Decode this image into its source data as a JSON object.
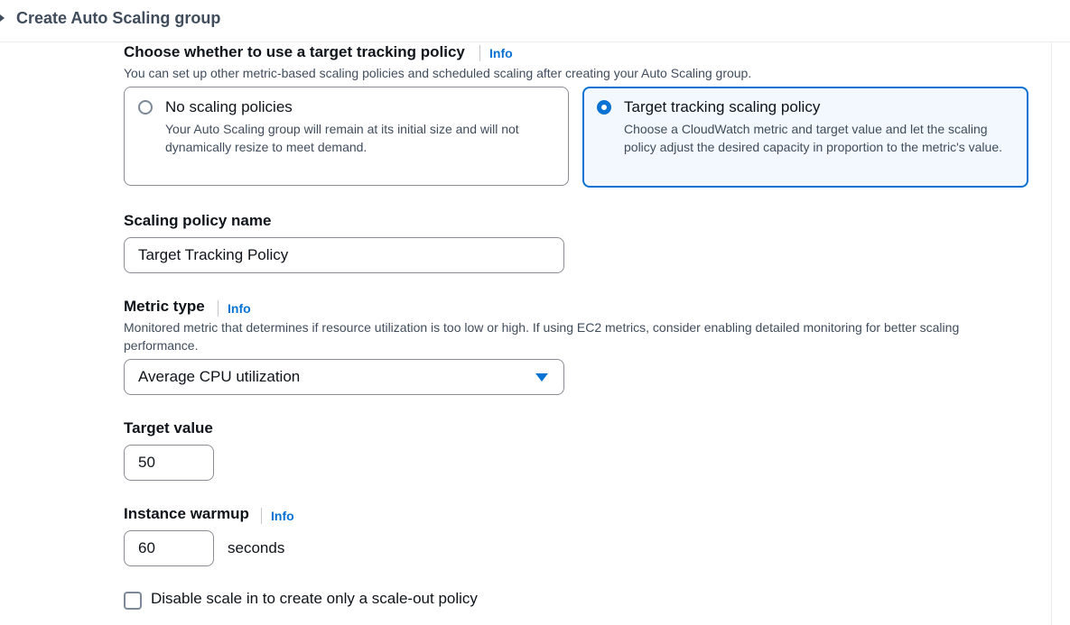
{
  "header": {
    "title": "Create Auto Scaling group"
  },
  "policy_choice": {
    "heading": "Choose whether to use a target tracking policy",
    "info": "Info",
    "description": "You can set up other metric-based scaling policies and scheduled scaling after creating your Auto Scaling group.",
    "options": [
      {
        "title": "No scaling policies",
        "description": "Your Auto Scaling group will remain at its initial size and will not dynamically resize to meet demand.",
        "selected": false
      },
      {
        "title": "Target tracking scaling policy",
        "description": "Choose a CloudWatch metric and target value and let the scaling policy adjust the desired capacity in proportion to the metric's value.",
        "selected": true
      }
    ]
  },
  "policy_name": {
    "label": "Scaling policy name",
    "value": "Target Tracking Policy"
  },
  "metric_type": {
    "label": "Metric type",
    "info": "Info",
    "description": "Monitored metric that determines if resource utilization is too low or high. If using EC2 metrics, consider enabling detailed monitoring for better scaling performance.",
    "selected": "Average CPU utilization"
  },
  "target_value": {
    "label": "Target value",
    "value": "50"
  },
  "warmup": {
    "label": "Instance warmup",
    "info": "Info",
    "value": "60",
    "unit": "seconds"
  },
  "disable_scale_in": {
    "label": "Disable scale in to create only a scale-out policy",
    "checked": false
  },
  "colors": {
    "accent": "#0972d3",
    "selected_bg": "#f2f8fd",
    "border": "#8c8c94",
    "text": "#0f141a",
    "secondary_text": "#414d5c"
  }
}
